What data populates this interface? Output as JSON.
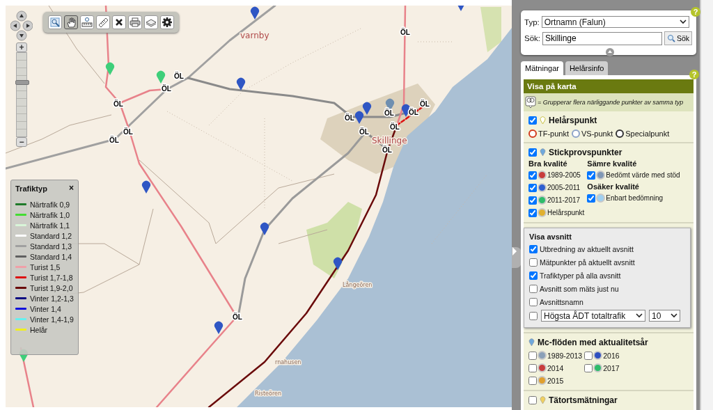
{
  "map": {
    "place_labels": [
      "varnby",
      "Skillinge",
      "Långeören",
      "rnahusen",
      "Risteören"
    ],
    "road_labels": [
      "ÖL",
      "ÖL",
      "ÖL",
      "ÖL",
      "ÖL",
      "ÖL",
      "ÖL",
      "ÖL",
      "ÖL",
      "ÖL",
      "ÖL",
      "ÖL",
      "ÖL",
      "ÖL"
    ],
    "pins": [
      {
        "color": "#3ecf7a"
      },
      {
        "color": "#3ecf7a"
      },
      {
        "color": "#3ecf7a"
      },
      {
        "color": "#2f56c4"
      },
      {
        "color": "#2f56c4"
      },
      {
        "color": "#2f56c4"
      },
      {
        "color": "#2f56c4"
      },
      {
        "color": "#2f56c4"
      },
      {
        "color": "#2f56c4"
      },
      {
        "color": "#2f56c4"
      },
      {
        "color": "#2f56c4"
      },
      {
        "color": "#6f8fb0"
      },
      {
        "color": "#2f56c4"
      },
      {
        "color": "#2f56c4"
      }
    ]
  },
  "zoom_control": {
    "zoom_in": "+",
    "zoom_out": "−",
    "level": 0.66
  },
  "toolbar": [
    {
      "kind": "zoom-box",
      "selected": false
    },
    {
      "kind": "pan",
      "selected": true
    },
    {
      "kind": "zoom-scale",
      "selected": false
    },
    {
      "kind": "measure",
      "selected": false
    },
    {
      "kind": "clear",
      "selected": false
    },
    {
      "kind": "print",
      "selected": false
    },
    {
      "kind": "layers",
      "selected": false
    },
    {
      "kind": "settings",
      "selected": false
    }
  ],
  "legend": {
    "title": "Trafiktyp",
    "close": "×",
    "items": [
      {
        "label": "Närtrafik 0,9",
        "color": "#1f7a2a"
      },
      {
        "label": "Närtrafik 1,0",
        "color": "#44dd33"
      },
      {
        "label": "Närtrafik 1,1",
        "color": "#d8f5d8"
      },
      {
        "label": "Standard 1,2",
        "color": "#ffffff"
      },
      {
        "label": "Standard 1,3",
        "color": "#a0a0a0"
      },
      {
        "label": "Standard 1,4",
        "color": "#606060"
      },
      {
        "label": "Turist 1,5",
        "color": "#f0a0a8"
      },
      {
        "label": "Turist 1,7-1,8",
        "color": "#dd1111"
      },
      {
        "label": "Turist 1,9-2,0",
        "color": "#6a0a0a"
      },
      {
        "label": "Vinter 1,2-1,3",
        "color": "#0a0a80"
      },
      {
        "label": "Vinter 1,4",
        "color": "#1010dd"
      },
      {
        "label": "Vinter 1,4-1,9",
        "color": "#66f0f0"
      },
      {
        "label": "Helår",
        "color": "#f0f020"
      }
    ]
  },
  "search": {
    "help": "?",
    "type_label": "Typ:",
    "type_value": "Ortnamn (Falun)",
    "search_label": "Sök:",
    "search_value": "Skillinge",
    "search_button": "Sök"
  },
  "tabs": [
    {
      "label": "Mätningar",
      "selected": true
    },
    {
      "label": "Helårsinfo",
      "selected": false
    }
  ],
  "panel": {
    "help": "?",
    "title": "Visa på karta",
    "note": "= Grupperar flera närliggande punkter av samma typ",
    "helarspunkt": {
      "title": "Helårspunkt",
      "checked": true,
      "markers": [
        {
          "label": "TF-punkt",
          "color": "#d23c1e"
        },
        {
          "label": "VS-punkt",
          "color": "#8fa4c8"
        },
        {
          "label": "Specialpunkt",
          "color": "#333333"
        }
      ]
    },
    "stickprov": {
      "title": "Stickprovspunkter",
      "checked": true,
      "groups": [
        {
          "title": "Bra kvalité",
          "items": [
            {
              "label": "1989-2005",
              "checked": true,
              "color": "#c83c3c"
            },
            {
              "label": "2005-2011",
              "checked": true,
              "color": "#2e5fd0"
            },
            {
              "label": "2011-2017",
              "checked": true,
              "color": "#2ebc6a"
            },
            {
              "label": "Helårspunkt",
              "checked": true,
              "color": "#e0b030"
            }
          ]
        },
        {
          "title": "Sämre kvalité",
          "items": [
            {
              "label": "Bedömt värde med stöd",
              "checked": true,
              "color": "#7f97b5"
            }
          ]
        },
        {
          "title": "Osäker kvalité",
          "items": [
            {
              "label": "Enbart bedömning",
              "checked": true,
              "color": "#9fd0f0"
            }
          ]
        }
      ]
    },
    "visa_avsnitt": {
      "title": "Visa avsnitt",
      "options": [
        {
          "label": "Utbredning av aktuellt avsnitt",
          "checked": true
        },
        {
          "label": "Mätpunkter på aktuellt avsnitt",
          "checked": false
        },
        {
          "label": "Trafiktyper på alla avsnitt",
          "checked": true
        },
        {
          "label": "Avsnitt som mäts just nu",
          "checked": false
        },
        {
          "label": "Avsnittsnamn",
          "checked": false
        }
      ],
      "filter": {
        "checked": false,
        "measure": "Högsta ÅDT totaltrafik",
        "count": "10"
      }
    },
    "mc": {
      "title": "Mc-flöden med aktualitetsår",
      "items": [
        {
          "label": "1989-2013",
          "checked": false,
          "color": "#8aa0b8"
        },
        {
          "label": "2016",
          "checked": false,
          "color": "#2e4fc0"
        },
        {
          "label": "2014",
          "checked": false,
          "color": "#c83c3c"
        },
        {
          "label": "2017",
          "checked": false,
          "color": "#2ebc6a"
        },
        {
          "label": "2015",
          "checked": false,
          "color": "#e0a030"
        }
      ]
    },
    "tatort": {
      "title": "Tätortsmätningar",
      "checked": false
    }
  }
}
